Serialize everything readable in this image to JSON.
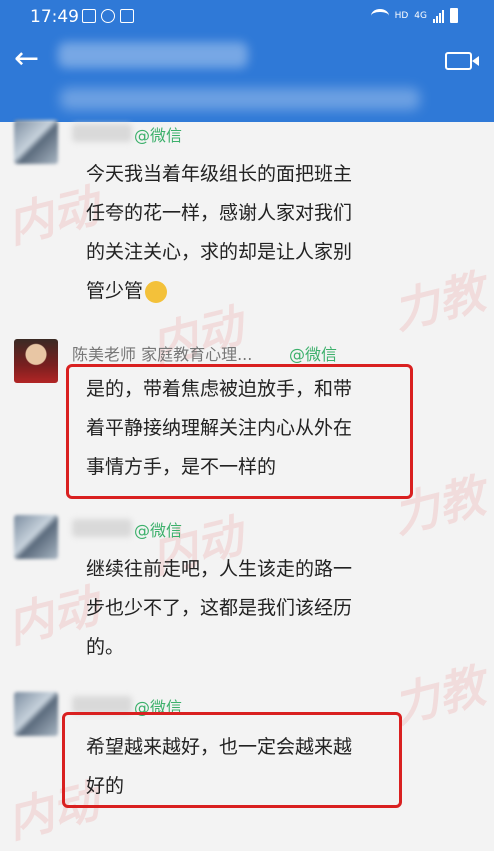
{
  "status": {
    "time": "17:49",
    "hd": "HD",
    "network": "4G"
  },
  "messages": [
    {
      "sender_suffix": "@微信",
      "lines": [
        "今天我当着年级组长的面把班主",
        "任夸的花一样，感谢人家对我们",
        "的关注关心，求的却是让人家别",
        "管少管"
      ]
    },
    {
      "sender_name": "陈美老师 家庭教育心理...",
      "sender_suffix": "@微信",
      "lines": [
        "是的，带着焦虑被迫放手，和带",
        "着平静接纳理解关注内心从外在",
        "事情方手，是不一样的"
      ]
    },
    {
      "sender_suffix": "@微信",
      "lines": [
        "继续往前走吧，人生该走的路一",
        "步也少不了，这都是我们该经历",
        "的。"
      ]
    },
    {
      "sender_suffix": "@微信",
      "lines": [
        "希望越来越好，也一定会越来越",
        "好的"
      ]
    }
  ],
  "watermark": {
    "text_a": "内动",
    "text_b": "力教",
    "color": "#e63c3c"
  },
  "colors": {
    "header": "#2f79d7",
    "highlight": "#d92020",
    "sender_green": "#3cb06b"
  }
}
